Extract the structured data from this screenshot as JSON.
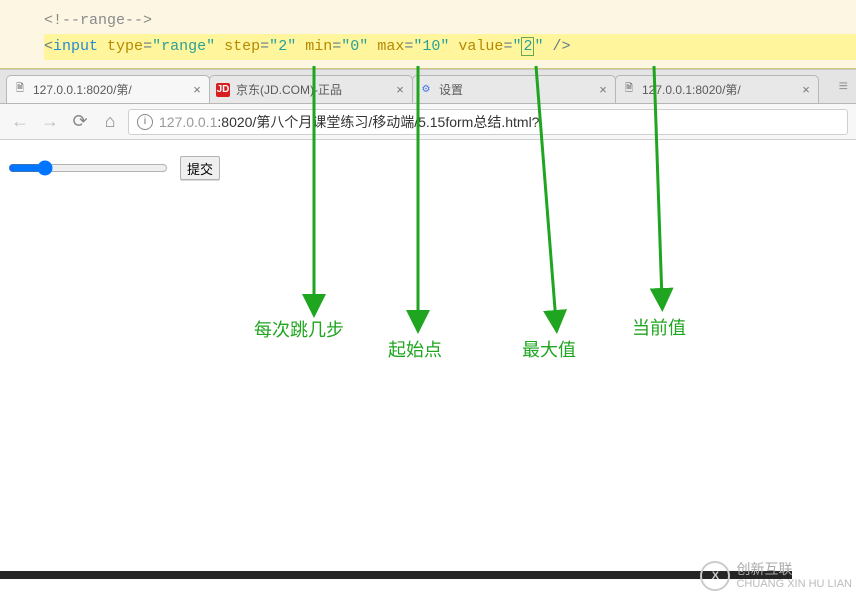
{
  "code": {
    "comment": "<!--range-->",
    "tag": "input",
    "attrs": {
      "type": "range",
      "step": "2",
      "min": "0",
      "max": "10",
      "value": "2"
    }
  },
  "tabs": [
    {
      "title": "127.0.0.1:8020/第/",
      "favicon": "page"
    },
    {
      "title": "京东(JD.COM)-正品",
      "favicon": "jd"
    },
    {
      "title": "设置",
      "favicon": "gear"
    },
    {
      "title": "127.0.0.1:8020/第/",
      "favicon": "page"
    }
  ],
  "toolbar": {
    "url_host": "127.0.0.1",
    "url_path": ":8020/第八个月课堂练习/移动端/5.15form总结.html?"
  },
  "page": {
    "submit_label": "提交",
    "range_value": "2"
  },
  "annotations": {
    "step": "每次跳几步",
    "min": "起始点",
    "max": "最大值",
    "value": "当前值"
  },
  "watermark": {
    "brand": "创新互联",
    "sub": "CHUANG XIN HU LIAN",
    "logo": "X"
  }
}
